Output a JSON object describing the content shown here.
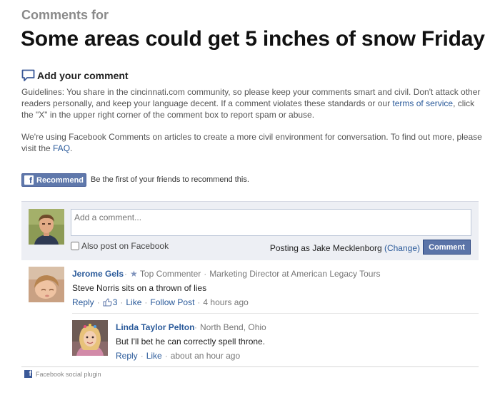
{
  "header": {
    "kicker": "Comments for",
    "headline": "Some areas could get 5 inches of snow Friday"
  },
  "add_comment": {
    "heading": "Add your comment",
    "guidelines_text": "Guidelines: You share in the cincinnati.com community, so please keep your comments smart and civil. Don't attack other readers personally, and keep your language decent. If a comment violates these standards or our ",
    "guidelines_link": "terms of service",
    "guidelines_tail": ", click the \"X\" in the upper right corner of the comment box to report spam or abuse.",
    "fb_note_text": "We're using Facebook Comments on articles to create a more civil environment for conversation. To find out more, please visit the ",
    "fb_note_link": "FAQ",
    "fb_note_tail": "."
  },
  "recommend": {
    "button_label": "Recommend",
    "text": "Be the first of your friends to recommend this."
  },
  "composer": {
    "placeholder": "Add a comment...",
    "also_post_label": "Also post on Facebook",
    "posting_as": "Posting as Jake Mecklenborg",
    "change_link": "(Change)",
    "submit_label": "Comment"
  },
  "comments": [
    {
      "name": "Jerome Gels",
      "badge": "Top Commenter",
      "detail": "Marketing Director at American Legacy Tours",
      "body": "Steve Norris sits on a thrown of lies",
      "reply": "Reply",
      "like_count": "3",
      "like": "Like",
      "follow": "Follow Post",
      "time": "4 hours ago"
    },
    {
      "name": "Linda Taylor Pelton",
      "detail": "North Bend, Ohio",
      "body": "But I'll bet he can correctly spell throne.",
      "reply": "Reply",
      "like": "Like",
      "time": "about an hour ago"
    }
  ],
  "footer": {
    "plugin_label": "Facebook social plugin"
  },
  "colors": {
    "link": "#2a5a9a",
    "facebook_blue": "#3b5998",
    "composer_bg": "#edeff4",
    "button_blue": "#5b74a8"
  },
  "icons": [
    "speech-bubble-icon",
    "facebook-f-icon",
    "star-icon",
    "thumbs-up-icon",
    "facebook-square-icon"
  ]
}
